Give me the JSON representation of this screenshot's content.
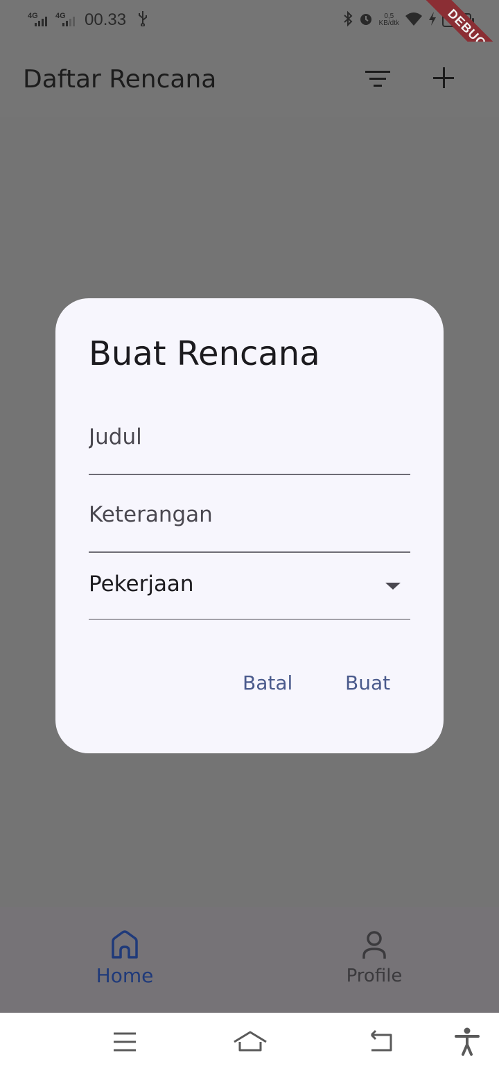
{
  "status_bar": {
    "network_1": "4G",
    "network_2": "4G",
    "time": "00.33",
    "net_speed_value": "0,5",
    "net_speed_unit": "KB/dtk"
  },
  "debug_banner": "DEBUG",
  "app_bar": {
    "title": "Daftar Rencana",
    "filter_icon": "filter-list-icon",
    "add_icon": "plus-icon"
  },
  "dialog": {
    "title": "Buat Rencana",
    "title_field_placeholder": "Judul",
    "description_field_placeholder": "Keterangan",
    "category_value": "Pekerjaan",
    "cancel_label": "Batal",
    "create_label": "Buat"
  },
  "bottom_nav": {
    "items": [
      {
        "label": "Home",
        "icon": "home-icon",
        "active": true
      },
      {
        "label": "Profile",
        "icon": "person-icon",
        "active": false
      }
    ]
  },
  "system_nav": {
    "buttons": [
      "menu-icon",
      "home-icon",
      "back-icon",
      "accessibility-icon"
    ]
  },
  "colors": {
    "scrim": "#747474",
    "dialog_bg": "#f7f6fd",
    "button_text": "#4a5a8c",
    "active_nav": "#1f3a7a",
    "debug_banner": "#8b2e34"
  }
}
